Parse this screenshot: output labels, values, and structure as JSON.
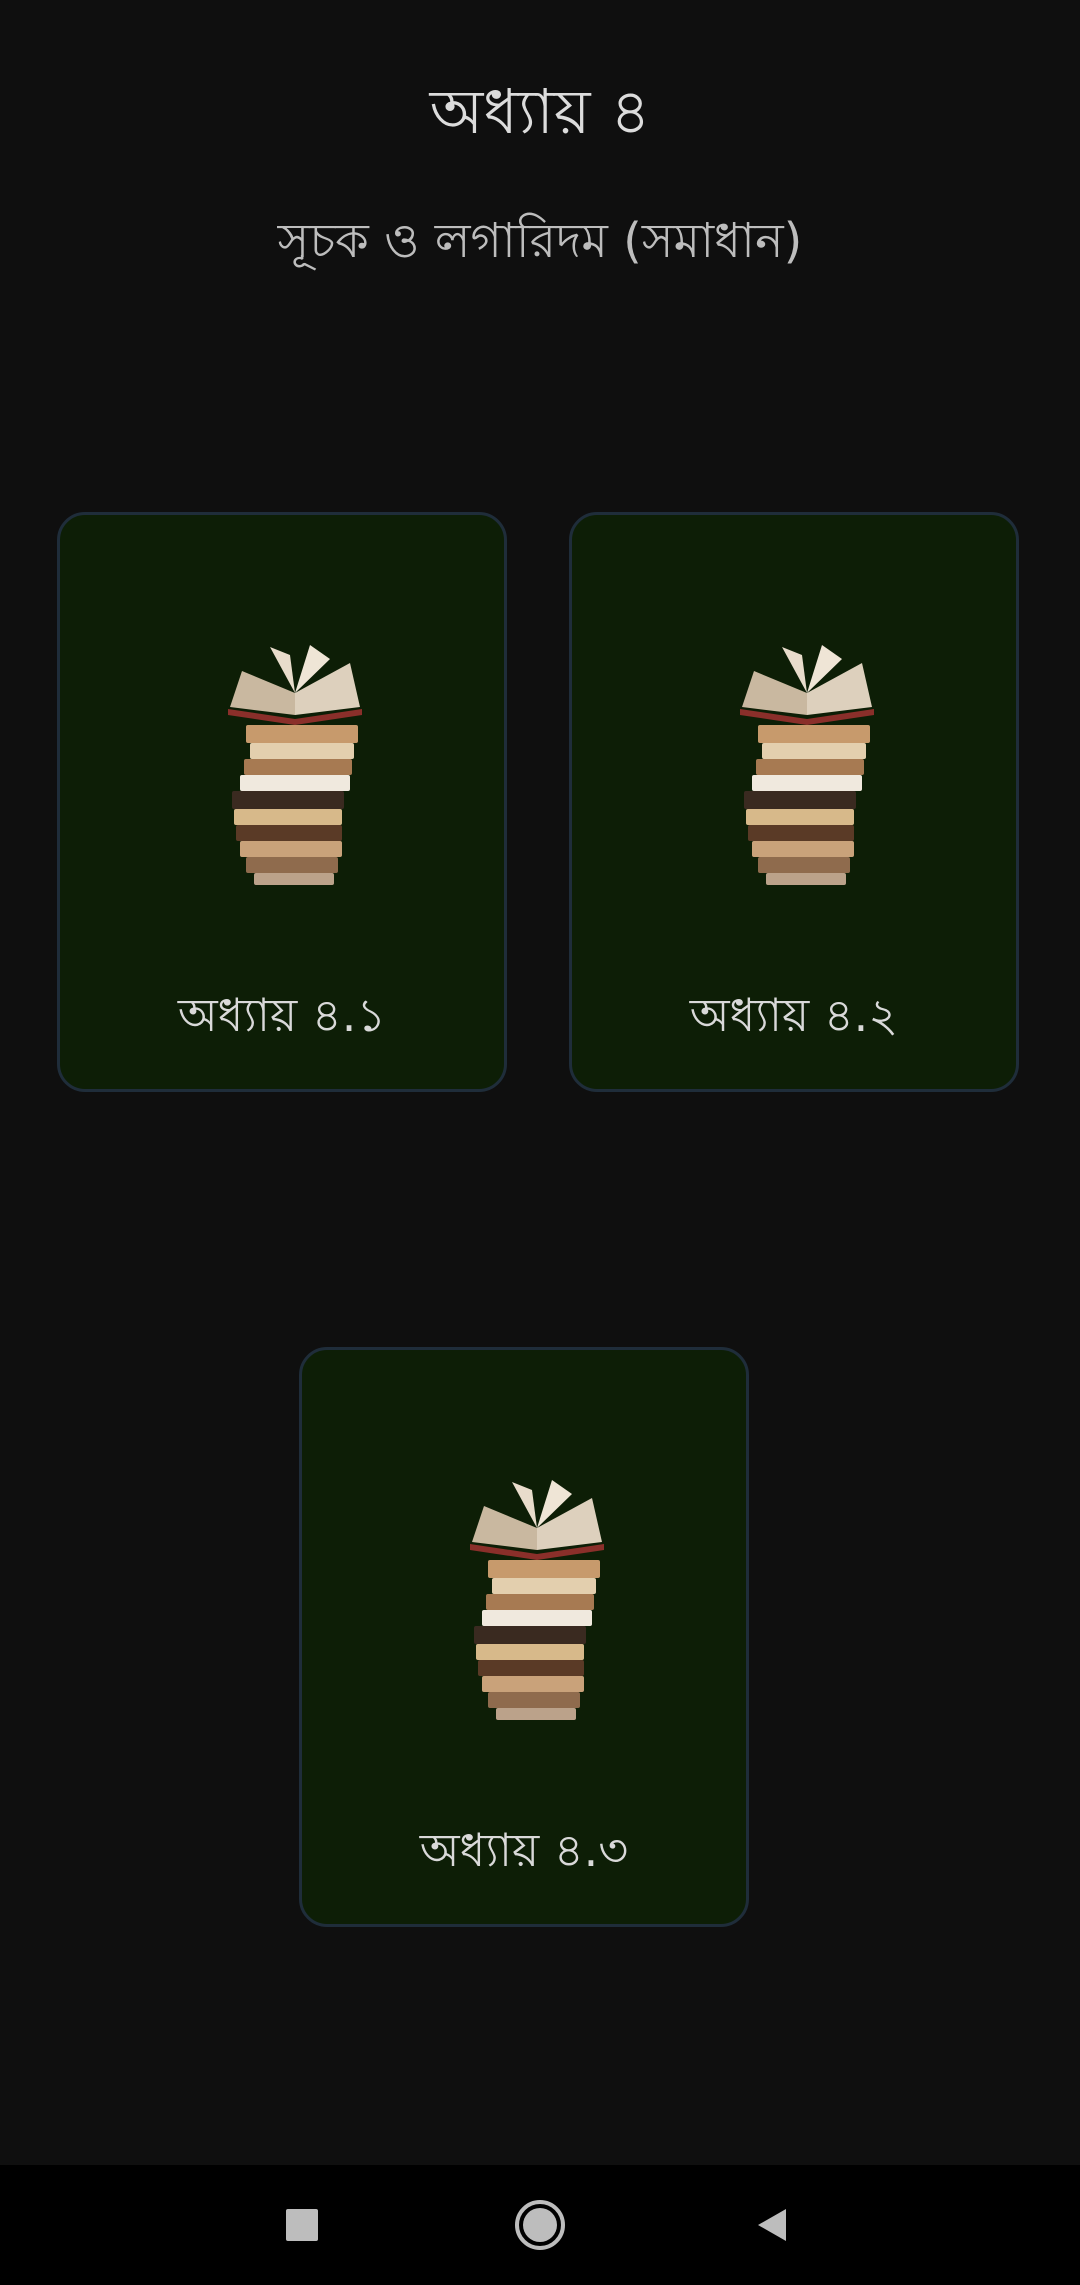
{
  "header": {
    "title": "অধ্যায় ৪",
    "subtitle": "সূচক ও লগারিদম (সমাধান)"
  },
  "cards": [
    {
      "label": "অধ্যায় ৪.১",
      "icon": "book-stack-icon"
    },
    {
      "label": "অধ্যায় ৪.২",
      "icon": "book-stack-icon"
    },
    {
      "label": "অধ্যায় ৪.৩",
      "icon": "book-stack-icon"
    }
  ],
  "navigation_bar": {
    "recents_icon": "square-icon",
    "home_icon": "circle-icon",
    "back_icon": "triangle-left-icon"
  },
  "colors": {
    "background": "#0f0f0f",
    "card_background": "#0d1e06",
    "card_border": "#1f2d3a",
    "nav_background": "#000000"
  }
}
